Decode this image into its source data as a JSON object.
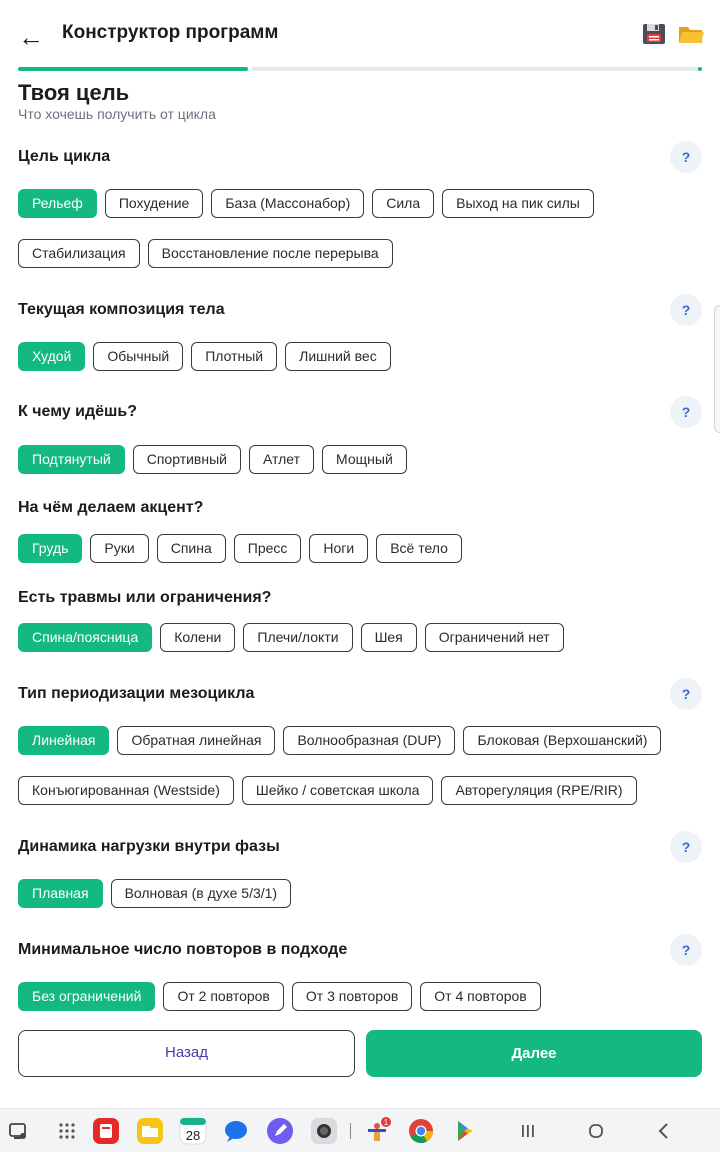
{
  "header": {
    "title": "Конструктор программ",
    "back_icon": "←"
  },
  "progress": {
    "current_step": 1,
    "total_steps": 2,
    "fraction": 0.34
  },
  "page": {
    "title": "Твоя цель",
    "subtitle": "Что хочешь получить от цикла"
  },
  "help_label": "?",
  "colors": {
    "accent": "#14b981",
    "help_bg": "#eef3f8",
    "help_fg": "#2f6fcf",
    "back_text": "#4b3aa8"
  },
  "sections": {
    "goal": {
      "title": "Цель цикла",
      "options_row1": [
        "Рельеф",
        "Похудение",
        "База (Массонабор)",
        "Сила",
        "Выход на пик силы"
      ],
      "options_row2": [
        "Стабилизация",
        "Восстановление после перерыва"
      ],
      "selected": "Рельеф"
    },
    "body": {
      "title": "Текущая композиция тела",
      "options": [
        "Худой",
        "Обычный",
        "Плотный",
        "Лишний вес"
      ],
      "selected": "Худой"
    },
    "target": {
      "title": "К чему идёшь?",
      "options": [
        "Подтянутый",
        "Спортивный",
        "Атлет",
        "Мощный"
      ],
      "selected": "Подтянутый"
    },
    "focus": {
      "title": "На чём делаем акцент?",
      "options": [
        "Грудь",
        "Руки",
        "Спина",
        "Пресс",
        "Ноги",
        "Всё тело"
      ],
      "selected": "Грудь"
    },
    "injuries": {
      "title": "Есть травмы или ограничения?",
      "options": [
        "Спина/поясница",
        "Колени",
        "Плечи/локти",
        "Шея",
        "Ограничений нет"
      ],
      "selected": "Спина/поясница"
    },
    "periodization": {
      "title": "Тип периодизации мезоцикла",
      "options_row1": [
        "Линейная",
        "Обратная линейная",
        "Волнообразная (DUP)",
        "Блоковая (Верхошанский)"
      ],
      "options_row2": [
        "Конъюгированная (Westside)",
        "Шейко / советская школа",
        "Авторегуляция (RPE/RIR)"
      ],
      "selected": "Линейная"
    },
    "dynamics": {
      "title": "Динамика нагрузки внутри фазы",
      "options": [
        "Плавная",
        "Волновая (в духе 5/3/1)"
      ],
      "selected": "Плавная"
    },
    "min_reps": {
      "title": "Минимальное число повторов в подходе",
      "options": [
        "Без ограничений",
        "От 2 повторов",
        "От 3 повторов",
        "От 4 повторов"
      ],
      "selected": "Без ограничений"
    }
  },
  "footer": {
    "back_label": "Назад",
    "next_label": "Далее"
  },
  "taskbar": {
    "calendar_day": "28",
    "badge_count": "1",
    "icons": [
      "screen-icon",
      "app-grid-icon",
      "red-app-icon",
      "files-folder-icon",
      "calendar-icon",
      "messages-icon",
      "notes-pen-icon",
      "camera-icon",
      "fitness-app-icon",
      "chrome-icon",
      "play-store-icon",
      "recents-icon",
      "home-icon",
      "back-nav-icon"
    ]
  }
}
